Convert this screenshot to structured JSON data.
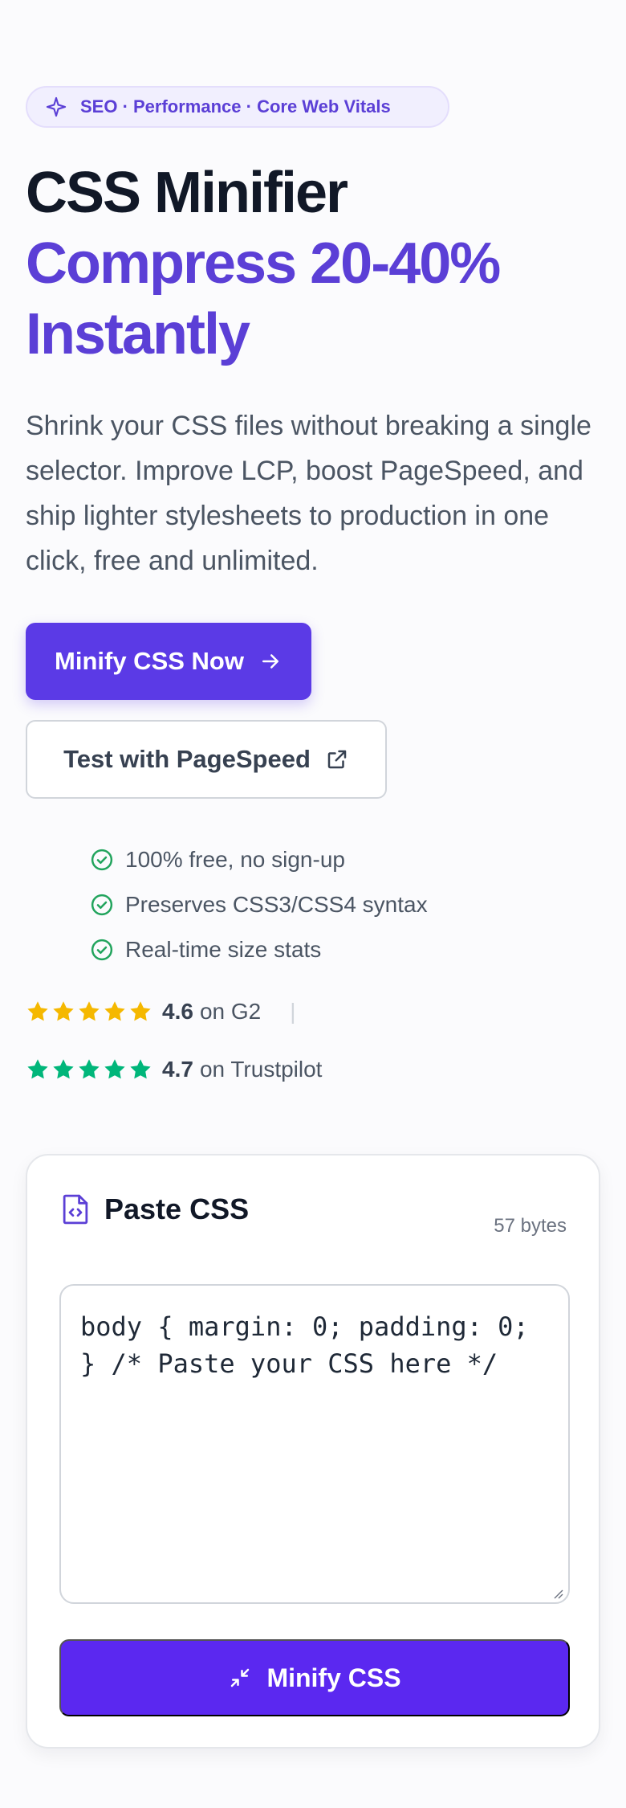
{
  "hero": {
    "badge": "SEO · Performance · Core Web Vitals",
    "title_line1": "CSS Minifier",
    "title_line2": "Compress 20-40% Instantly",
    "description": "Shrink your CSS files without breaking a single selector. Improve LCP, boost PageSpeed, and ship lighter stylesheets to production in one click, free and unlimited.",
    "primary_button": "Minify CSS Now",
    "secondary_button": "Test with PageSpeed",
    "features": [
      "100% free, no sign-up",
      "Preserves CSS3/CSS4 syntax",
      "Real-time size stats"
    ],
    "ratings": [
      {
        "score": "4.6",
        "label": "on G2",
        "stars": 5,
        "color": "#f5b800"
      },
      {
        "score": "4.7",
        "label": "on Trustpilot",
        "stars": 5,
        "color": "#00b67a"
      }
    ],
    "rating_separator": "|"
  },
  "editor": {
    "title": "Paste CSS",
    "byte_count": "57 bytes",
    "code": "body { margin: 0; padding: 0; } /* Paste your CSS here */",
    "minify_button": "Minify CSS"
  },
  "colors": {
    "accent": "#5b3ae6",
    "check": "#22a45d",
    "text_muted": "#4b5563"
  },
  "icons": {
    "badge": "sparkle-icon",
    "primary": "arrow-right-icon",
    "secondary": "external-link-icon",
    "feature": "check-circle-icon",
    "editor": "code-file-icon",
    "minify": "compress-icon"
  }
}
